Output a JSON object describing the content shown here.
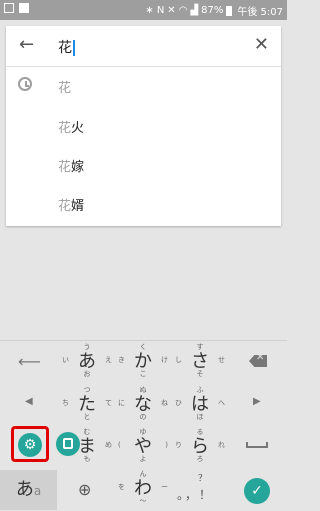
{
  "status_bar": {
    "time": "午後 5:07",
    "battery": "87%",
    "indicators": [
      "bluetooth-icon",
      "nfc-icon",
      "mute-icon",
      "wifi-icon",
      "signal-icon"
    ]
  },
  "search": {
    "query": "花",
    "back_icon": "arrow-back-icon",
    "clear_icon": "close-icon"
  },
  "suggestions": [
    {
      "prefix": "花",
      "rest": "",
      "history": true
    },
    {
      "prefix": "花",
      "rest": "火",
      "history": false
    },
    {
      "prefix": "花",
      "rest": "嫁",
      "history": false
    },
    {
      "prefix": "花",
      "rest": "婿",
      "history": false
    }
  ],
  "keyboard": {
    "keys": [
      {
        "main": "あ",
        "up": "う",
        "left": "い",
        "right": "え",
        "down": "お"
      },
      {
        "main": "か",
        "up": "く",
        "left": "き",
        "right": "け",
        "down": "こ"
      },
      {
        "main": "さ",
        "up": "す",
        "left": "し",
        "right": "せ",
        "down": "そ"
      },
      {
        "main": "た",
        "up": "つ",
        "left": "ち",
        "right": "て",
        "down": "と"
      },
      {
        "main": "な",
        "up": "ぬ",
        "left": "に",
        "right": "ね",
        "down": "の"
      },
      {
        "main": "は",
        "up": "ふ",
        "left": "ひ",
        "right": "へ",
        "down": "ほ"
      },
      {
        "main": "ま",
        "up": "む",
        "left": "み",
        "right": "め",
        "down": "も"
      },
      {
        "main": "や",
        "up": "ゆ",
        "left": "(",
        "right": ")",
        "down": "よ"
      },
      {
        "main": "ら",
        "up": "る",
        "left": "り",
        "right": "れ",
        "down": "ろ"
      },
      {
        "main": "わ",
        "up": "ん",
        "left": "を",
        "right": "ー",
        "down": "〜"
      }
    ],
    "mode_main": "あ",
    "mode_sub": "a",
    "punctuation": "。，！",
    "punct_q": "？",
    "accent_color": "#26a69a",
    "highlight_color": "#e00000"
  }
}
